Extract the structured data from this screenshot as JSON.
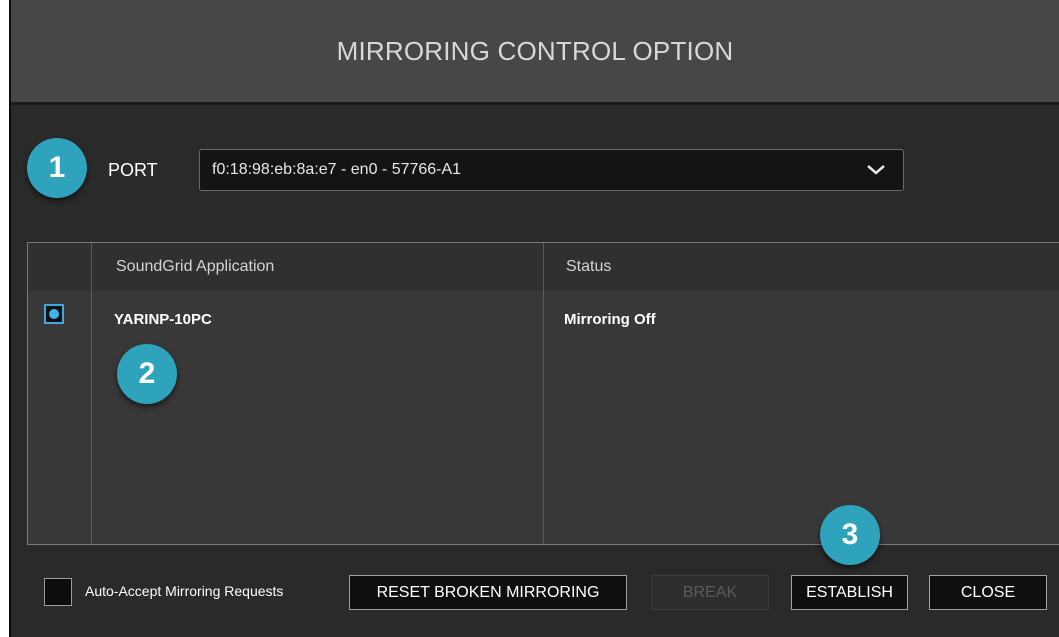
{
  "dialog": {
    "title": "MIRRORING CONTROL OPTION"
  },
  "port": {
    "label": "PORT",
    "selected_value": "f0:18:98:eb:8a:e7 - en0 - 57766-A1",
    "dropdown_icon": "chevron-down-icon"
  },
  "table": {
    "columns": [
      "SoundGrid Application",
      "Status"
    ],
    "rows": [
      {
        "selected": true,
        "application": "YARINP-10PC",
        "status": "Mirroring Off"
      }
    ]
  },
  "callouts": [
    "1",
    "2",
    "3"
  ],
  "footer": {
    "auto_accept_label": "Auto-Accept Mirroring Requests",
    "auto_accept_checked": false,
    "buttons": {
      "reset": "RESET BROKEN MIRRORING",
      "break": "BREAK",
      "establish": "ESTABLISH",
      "close": "CLOSE"
    }
  },
  "colors": {
    "accent": "#3fb4ea",
    "callout": "#2ea3bb",
    "titlebar": "#474747",
    "background": "#2a2a2a"
  }
}
